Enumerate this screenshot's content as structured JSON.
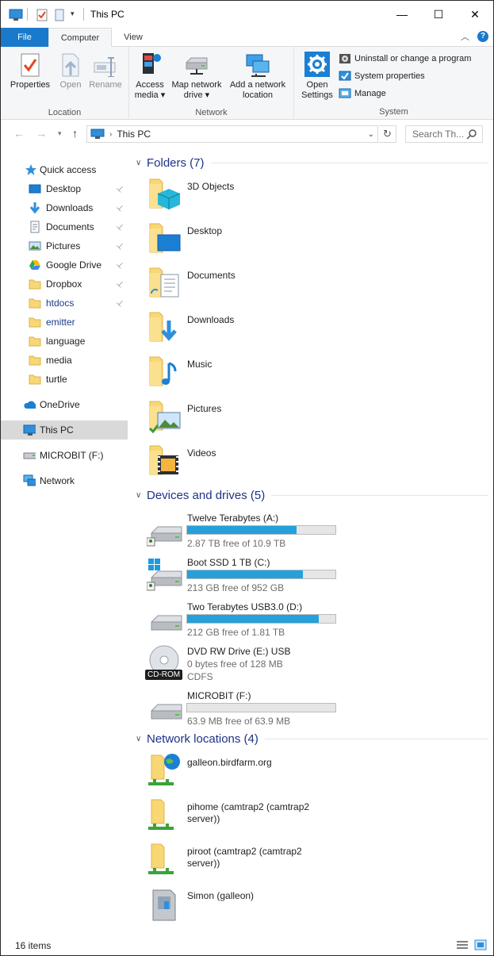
{
  "window": {
    "title": "This PC",
    "minimize": "—",
    "maximize": "☐",
    "close": "✕"
  },
  "ribbon_tabs": {
    "file": "File",
    "computer": "Computer",
    "view": "View"
  },
  "ribbon": {
    "location": {
      "label": "Location",
      "properties": "Properties",
      "open": "Open",
      "rename": "Rename"
    },
    "network": {
      "label": "Network",
      "access_media_line1": "Access",
      "access_media_line2": "media ▾",
      "map_drive_line1": "Map network",
      "map_drive_line2": "drive ▾",
      "add_location_line1": "Add a network",
      "add_location_line2": "location"
    },
    "system": {
      "label": "System",
      "open_settings_line1": "Open",
      "open_settings_line2": "Settings",
      "uninstall": "Uninstall or change a program",
      "system_properties": "System properties",
      "manage": "Manage"
    }
  },
  "address": {
    "path": "This PC",
    "search_placeholder": "Search Th..."
  },
  "sidebar": {
    "quick_access": "Quick access",
    "pinned": [
      {
        "label": "Desktop",
        "icon": "desktop-icon"
      },
      {
        "label": "Downloads",
        "icon": "downloads-icon"
      },
      {
        "label": "Documents",
        "icon": "documents-icon"
      },
      {
        "label": "Pictures",
        "icon": "pictures-icon"
      },
      {
        "label": "Google Drive",
        "icon": "google-drive-icon"
      },
      {
        "label": "Dropbox",
        "icon": "folder-icon"
      },
      {
        "label": "htdocs",
        "icon": "folder-icon"
      }
    ],
    "recent": [
      {
        "label": "emitter",
        "icon": "folder-icon"
      },
      {
        "label": "language",
        "icon": "folder-icon"
      },
      {
        "label": "media",
        "icon": "folder-icon"
      },
      {
        "label": "turtle",
        "icon": "folder-icon"
      }
    ],
    "onedrive": "OneDrive",
    "this_pc": "This PC",
    "microbit": "MICROBIT (F:)",
    "network": "Network"
  },
  "content": {
    "folders_header": "Folders (7)",
    "folders": [
      {
        "label": "3D Objects",
        "icon": "3d-objects-folder-icon"
      },
      {
        "label": "Desktop",
        "icon": "desktop-folder-icon"
      },
      {
        "label": "Documents",
        "icon": "documents-folder-icon"
      },
      {
        "label": "Downloads",
        "icon": "downloads-folder-icon"
      },
      {
        "label": "Music",
        "icon": "music-folder-icon"
      },
      {
        "label": "Pictures",
        "icon": "pictures-folder-icon"
      },
      {
        "label": "Videos",
        "icon": "videos-folder-icon"
      }
    ],
    "drives_header": "Devices and drives (5)",
    "drives": [
      {
        "name": "Twelve Terabytes (A:)",
        "free": "2.87 TB free of 10.9 TB",
        "used_fraction": 0.74
      },
      {
        "name": "Boot SSD 1 TB (C:)",
        "free": "213 GB free of 952 GB",
        "used_fraction": 0.78
      },
      {
        "name": "Two Terabytes USB3.0 (D:)",
        "free": "212 GB free of 1.81 TB",
        "used_fraction": 0.89
      },
      {
        "name": "DVD RW Drive (E:) USB",
        "free": "0 bytes free of 128 MB",
        "filesystem": "CDFS",
        "badge": "CD-ROM"
      },
      {
        "name": "MICROBIT (F:)",
        "free": "63.9 MB free of 63.9 MB",
        "used_fraction": 0.0
      }
    ],
    "network_header": "Network locations (4)",
    "network_locations": [
      {
        "label": "galleon.birdfarm.org"
      },
      {
        "label": "pihome (camtrap2 (camtrap2 server))"
      },
      {
        "label": "piroot (camtrap2 (camtrap2 server))"
      },
      {
        "label": "Simon (galleon)"
      }
    ]
  },
  "status": {
    "items": "16 items"
  },
  "colors": {
    "accent": "#1979ca",
    "drive_bar": "#26a0da",
    "section_header": "#1e3287",
    "folder_yellow": "#f8d775"
  }
}
